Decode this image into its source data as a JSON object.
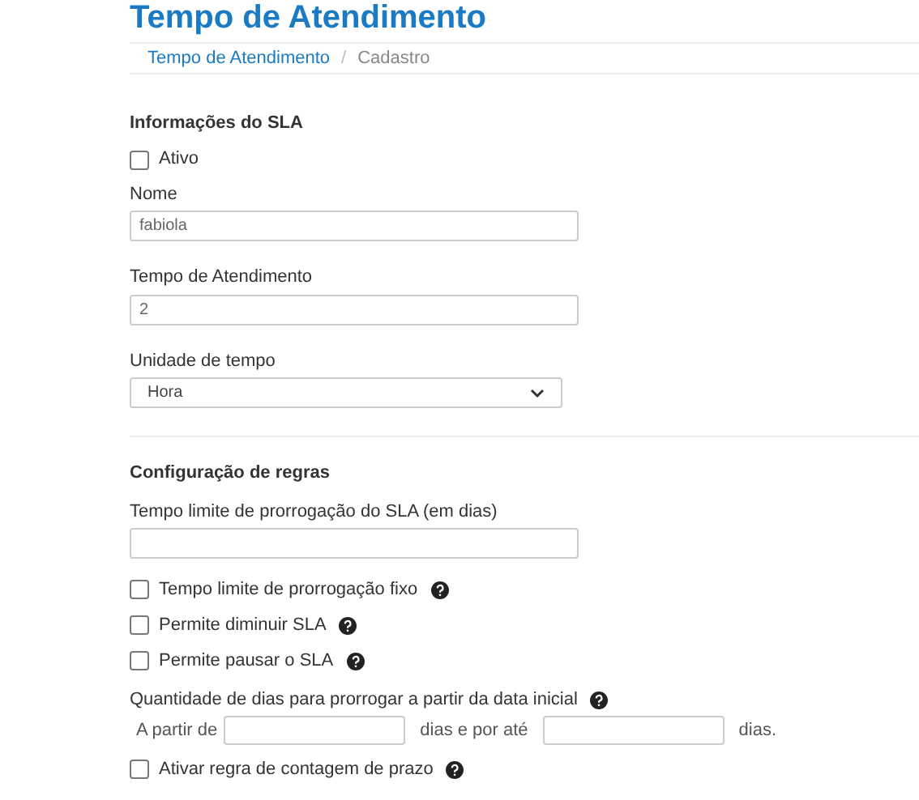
{
  "title": "Tempo de Atendimento",
  "breadcrumb": [
    {
      "label": "Tempo de Atendimento",
      "kind": "link"
    },
    {
      "label": "Cadastro",
      "kind": "current"
    }
  ],
  "breadcrumb_separator": "/",
  "sla_info": {
    "heading": "Informações do SLA",
    "active": {
      "label": "Ativo",
      "checked": false
    },
    "name": {
      "label": "Nome",
      "value": "fabiola"
    },
    "time": {
      "label": "Tempo de Atendimento",
      "value": "2"
    },
    "unit": {
      "label": "Unidade de tempo",
      "value": "Hora"
    }
  },
  "rules": {
    "heading": "Configuração de regras",
    "limit": {
      "label": "Tempo limite de prorrogação do SLA (em dias)"
    },
    "options": [
      {
        "label": "Tempo limite de prorrogação fixo",
        "checked": false,
        "help": true
      },
      {
        "label": "Permite diminuir SLA",
        "checked": false,
        "help": true
      },
      {
        "label": "Permite pausar o SLA",
        "checked": false,
        "help": true
      }
    ],
    "extension": {
      "label": "Quantidade de dias para prorrogar a partir da data inicial",
      "help": true,
      "from": "A partir de",
      "middle": "dias e por até",
      "end": "dias."
    },
    "deadline": {
      "label": "Ativar regra de contagem de prazo",
      "checked": false,
      "help": true
    }
  }
}
